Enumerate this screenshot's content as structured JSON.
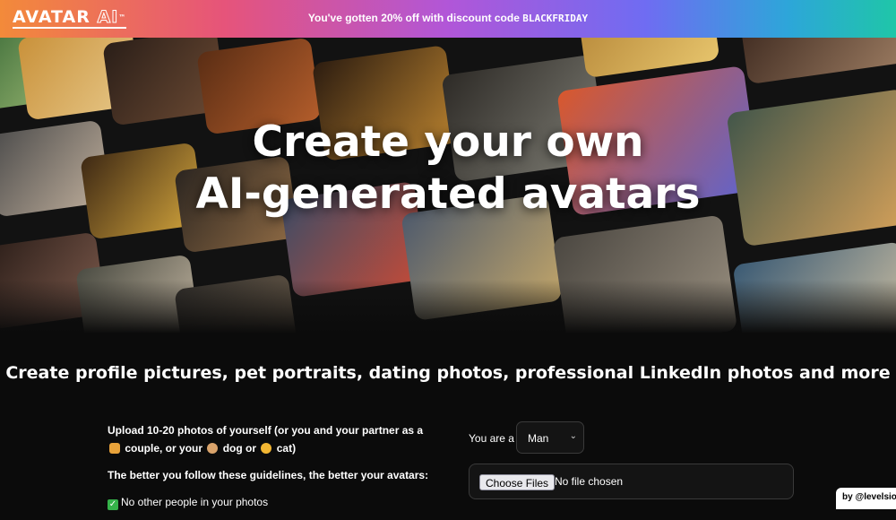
{
  "brand": {
    "logo_main": "AVATAR",
    "logo_ai": "AI",
    "logo_tm": "™"
  },
  "promo": {
    "text": "You've gotten 20% off with discount code",
    "code": "BLACKFRIDAY"
  },
  "hero": {
    "title_line1": "Create your own",
    "title_line2": "AI-generated avatars"
  },
  "subheading": "Create profile pictures, pet portraits, dating photos, professional LinkedIn photos and more",
  "instructions": {
    "upload_line1": "Upload 10-20 photos of yourself (or you and your partner as a",
    "couple_word": "couple, or your",
    "dog_word": "dog or",
    "cat_word": "cat)",
    "guidelines_text": "The better you follow these guidelines, the better your avatars:",
    "rule1": "No other people in your photos"
  },
  "form": {
    "you_are_label": "You are a",
    "gender_selected": "Man",
    "choose_files_label": "Choose Files",
    "no_file_text": "No file chosen"
  },
  "footer": {
    "byline": "by @levelsio"
  },
  "colors": {
    "gradient_start": "#f38a3a",
    "gradient_mid": "#b156d8",
    "gradient_end": "#1fc6a8",
    "background": "#0b0b0b"
  }
}
